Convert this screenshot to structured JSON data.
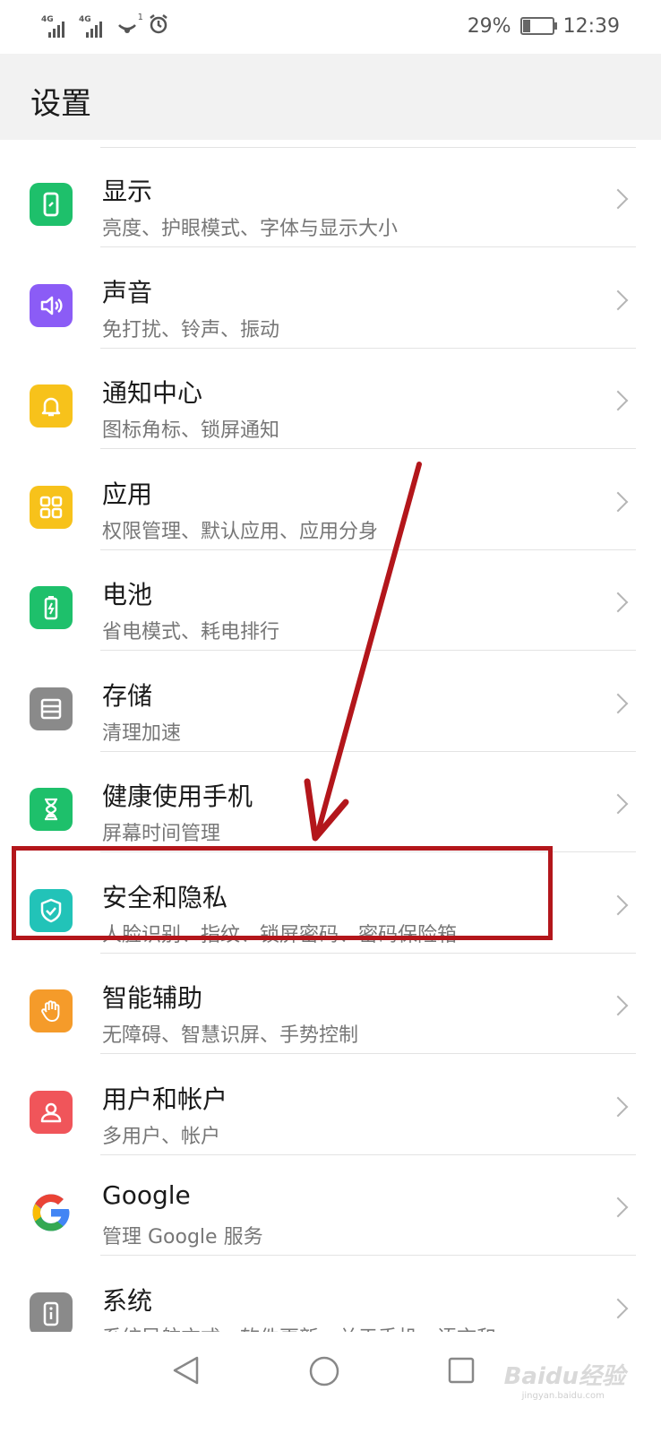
{
  "status_bar": {
    "signal1_tag": "4G",
    "signal2_tag": "4G",
    "notification_count": "1",
    "battery_percent": "29%",
    "battery_level": 0.29,
    "time": "12:39"
  },
  "header": {
    "title": "设置"
  },
  "settings": {
    "items": [
      {
        "title": "显示",
        "subtitle": "亮度、护眼模式、字体与显示大小",
        "icon": "display-icon",
        "color": "#1ec06b"
      },
      {
        "title": "声音",
        "subtitle": "免打扰、铃声、振动",
        "icon": "sound-icon",
        "color": "#8b5cf6"
      },
      {
        "title": "通知中心",
        "subtitle": "图标角标、锁屏通知",
        "icon": "bell-icon",
        "color": "#f7c21b"
      },
      {
        "title": "应用",
        "subtitle": "权限管理、默认应用、应用分身",
        "icon": "apps-grid-icon",
        "color": "#f7c21b"
      },
      {
        "title": "电池",
        "subtitle": "省电模式、耗电排行",
        "icon": "battery-icon",
        "color": "#1ec06b"
      },
      {
        "title": "存储",
        "subtitle": "清理加速",
        "icon": "storage-icon",
        "color": "#8a8a8a"
      },
      {
        "title": "健康使用手机",
        "subtitle": "屏幕时间管理",
        "icon": "hourglass-icon",
        "color": "#1ec06b"
      },
      {
        "title": "安全和隐私",
        "subtitle": "人脸识别、指纹、锁屏密码、密码保险箱",
        "icon": "shield-check-icon",
        "color": "#22c3b8"
      },
      {
        "title": "智能辅助",
        "subtitle": "无障碍、智慧识屏、手势控制",
        "icon": "hand-icon",
        "color": "#f59b2a"
      },
      {
        "title": "用户和帐户",
        "subtitle": "多用户、帐户",
        "icon": "user-icon",
        "color": "#f0555a"
      },
      {
        "title": "Google",
        "subtitle": "管理 Google 服务",
        "icon": "google-icon",
        "color": "#ffffff"
      },
      {
        "title": "系统",
        "subtitle": "系统导航方式、软件更新、关于手机、语言和",
        "icon": "system-info-icon",
        "color": "#8a8a8a"
      }
    ]
  },
  "watermark": {
    "brand": "Baidu经验",
    "url": "jingyan.baidu.com"
  },
  "annotation": {
    "arrow_color": "#b3161b",
    "box_color": "#b3161b"
  }
}
